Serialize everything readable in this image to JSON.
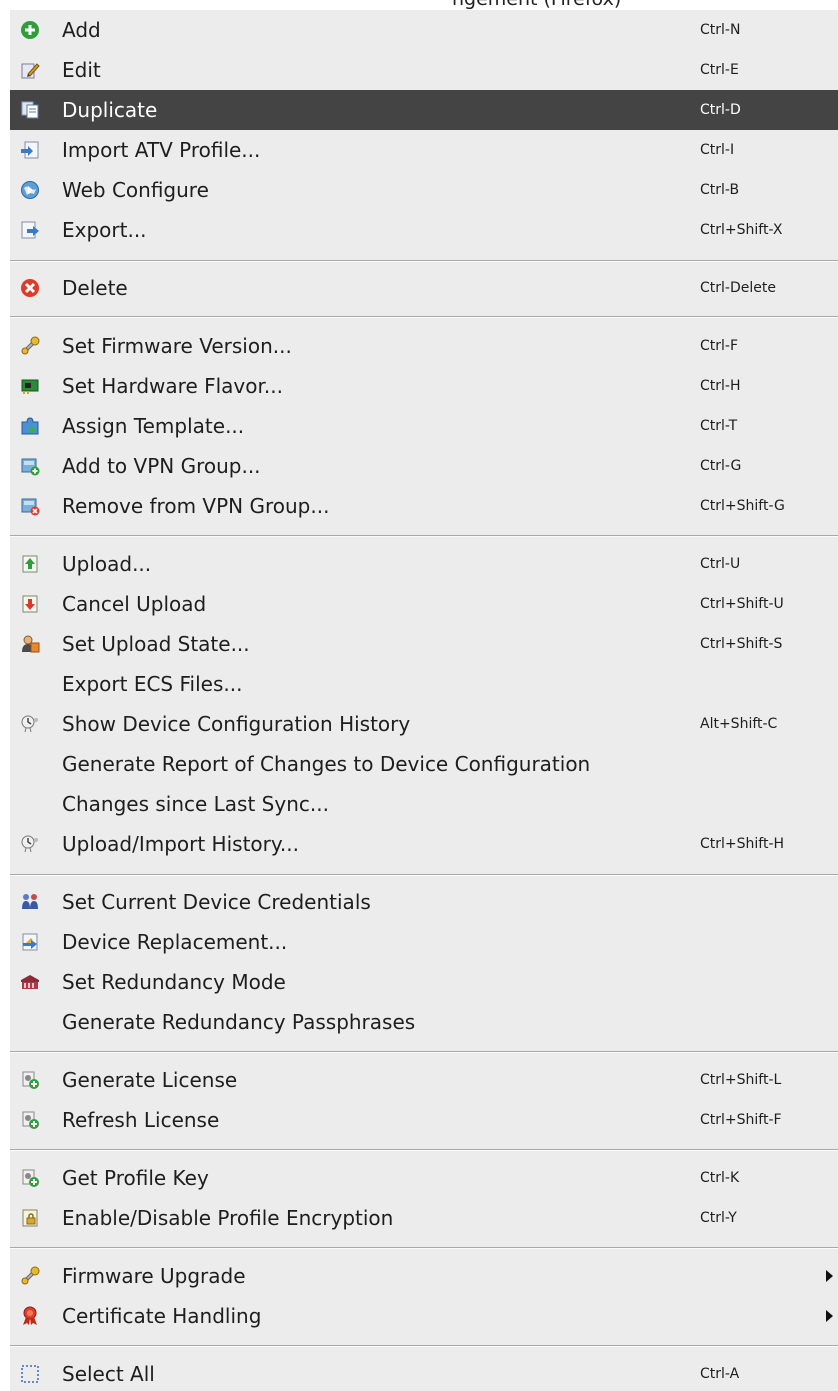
{
  "window_title": "ngement (Firefox)",
  "menu": {
    "items": [
      {
        "label": "Add",
        "shortcut": "Ctrl-N",
        "icon": "add-icon"
      },
      {
        "label": "Edit",
        "shortcut": "Ctrl-E",
        "icon": "edit-icon"
      },
      {
        "label": "Duplicate",
        "shortcut": "Ctrl-D",
        "icon": "duplicate-icon"
      },
      {
        "label": "Import ATV Profile...",
        "shortcut": "Ctrl-I",
        "icon": "import-icon"
      },
      {
        "label": "Web Configure",
        "shortcut": "Ctrl-B",
        "icon": "web-icon"
      },
      {
        "label": "Export...",
        "shortcut": "Ctrl+Shift-X",
        "icon": "export-icon"
      },
      {
        "label": "Delete",
        "shortcut": "Ctrl-Delete",
        "icon": "delete-icon"
      },
      {
        "label": "Set Firmware Version...",
        "shortcut": "Ctrl-F",
        "icon": "firmware-icon"
      },
      {
        "label": "Set Hardware Flavor...",
        "shortcut": "Ctrl-H",
        "icon": "hardware-chip-icon"
      },
      {
        "label": "Assign Template...",
        "shortcut": "Ctrl-T",
        "icon": "puzzle-icon"
      },
      {
        "label": "Add to VPN Group...",
        "shortcut": "Ctrl-G",
        "icon": "vpn-add-icon"
      },
      {
        "label": "Remove from VPN Group...",
        "shortcut": "Ctrl+Shift-G",
        "icon": "vpn-remove-icon"
      },
      {
        "label": "Upload...",
        "shortcut": "Ctrl-U",
        "icon": "upload-icon"
      },
      {
        "label": "Cancel Upload",
        "shortcut": "Ctrl+Shift-U",
        "icon": "cancel-upload-icon"
      },
      {
        "label": "Set Upload State...",
        "shortcut": "Ctrl+Shift-S",
        "icon": "upload-state-icon"
      },
      {
        "label": "Export ECS Files...",
        "shortcut": "",
        "icon": ""
      },
      {
        "label": "Show Device Configuration History",
        "shortcut": "Alt+Shift-C",
        "icon": "history-icon"
      },
      {
        "label": "Generate Report of Changes to Device Configuration",
        "shortcut": "",
        "icon": ""
      },
      {
        "label": "Changes since Last Sync...",
        "shortcut": "",
        "icon": ""
      },
      {
        "label": "Upload/Import History...",
        "shortcut": "Ctrl+Shift-H",
        "icon": "history-icon"
      },
      {
        "label": "Set Current Device Credentials",
        "shortcut": "",
        "icon": "credentials-icon"
      },
      {
        "label": "Device Replacement...",
        "shortcut": "",
        "icon": "replacement-icon"
      },
      {
        "label": "Set Redundancy Mode",
        "shortcut": "",
        "icon": "redundancy-icon"
      },
      {
        "label": "Generate Redundancy Passphrases",
        "shortcut": "",
        "icon": ""
      },
      {
        "label": "Generate License",
        "shortcut": "Ctrl+Shift-L",
        "icon": "license-icon"
      },
      {
        "label": "Refresh License",
        "shortcut": "Ctrl+Shift-F",
        "icon": "license-icon"
      },
      {
        "label": "Get Profile Key",
        "shortcut": "Ctrl-K",
        "icon": "license-icon"
      },
      {
        "label": "Enable/Disable Profile Encryption",
        "shortcut": "Ctrl-Y",
        "icon": "encryption-icon"
      },
      {
        "label": "Firmware Upgrade",
        "shortcut": "",
        "icon": "firmware-icon"
      },
      {
        "label": "Certificate Handling",
        "shortcut": "",
        "icon": "certificate-icon"
      },
      {
        "label": "Select All",
        "shortcut": "Ctrl-A",
        "icon": "select-all-icon"
      }
    ]
  },
  "colors": {
    "menu_background": "#ececec",
    "highlight_background": "#444444",
    "highlight_text": "#ffffff",
    "text": "#1e1e1e"
  }
}
